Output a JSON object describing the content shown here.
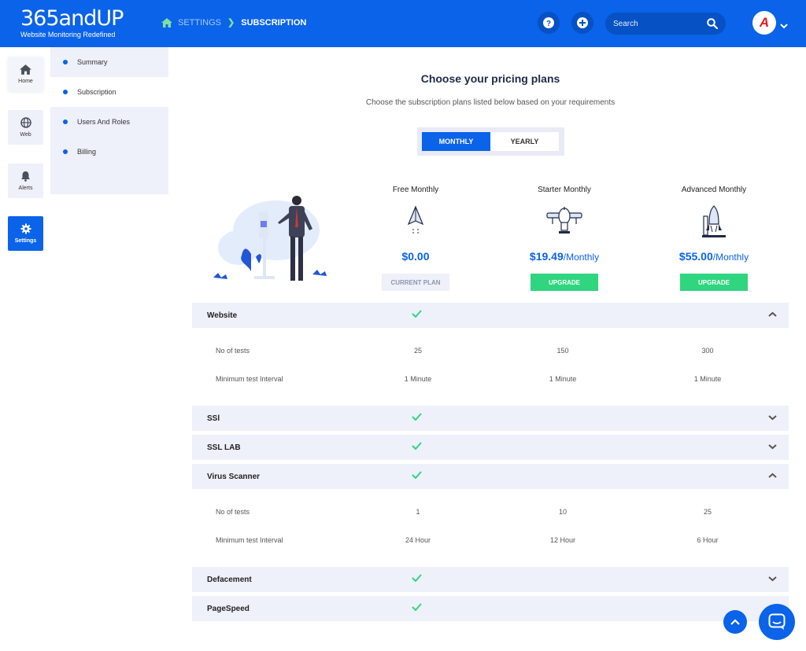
{
  "brand": {
    "name": "365andUP",
    "tagline": "Website Monitoring Redefined"
  },
  "breadcrumb": {
    "section": "SETTINGS",
    "current": "SUBSCRIPTION"
  },
  "header": {
    "search_placeholder": "Search",
    "avatar_letter": "A"
  },
  "leftnav": [
    {
      "label": "Home",
      "icon": "home-icon"
    },
    {
      "label": "Web",
      "icon": "globe-icon"
    },
    {
      "label": "Alerts",
      "icon": "bell-icon"
    },
    {
      "label": "Settings",
      "icon": "gear-icon",
      "active": true
    }
  ],
  "subnav": [
    {
      "label": "Summary"
    },
    {
      "label": "Subscription",
      "active": true
    },
    {
      "label": "Users And Roles"
    },
    {
      "label": "Billing"
    }
  ],
  "main": {
    "title": "Choose your pricing plans",
    "subtitle": "Choose the subscription plans listed below based on your requirements",
    "toggle": {
      "monthly": "MONTHLY",
      "yearly": "YEARLY",
      "selected": "MONTHLY"
    }
  },
  "plans": [
    {
      "name": "Free Monthly",
      "price": "$0.00",
      "period": "",
      "button": "CURRENT PLAN",
      "icon": "paper-plane-icon"
    },
    {
      "name": "Starter Monthly",
      "price": "$19.49",
      "period": "/Monthly",
      "button": "UPGRADE",
      "icon": "airplane-icon"
    },
    {
      "name": "Advanced Monthly",
      "price": "$55.00",
      "period": "/Monthly",
      "button": "UPGRADE",
      "icon": "rocket-icon"
    }
  ],
  "features": [
    {
      "name": "Website",
      "expanded": true,
      "rows": [
        {
          "label": "No of tests",
          "values": [
            "25",
            "150",
            "300"
          ]
        },
        {
          "label": "Minimum test Interval",
          "values": [
            "1 Minute",
            "1 Minute",
            "1 Minute"
          ]
        }
      ]
    },
    {
      "name": "SSl",
      "expanded": false
    },
    {
      "name": "SSL LAB",
      "expanded": false
    },
    {
      "name": "Virus Scanner",
      "expanded": true,
      "rows": [
        {
          "label": "No of tests",
          "values": [
            "1",
            "10",
            "25"
          ]
        },
        {
          "label": "Minimum test Interval",
          "values": [
            "24 Hour",
            "12 Hour",
            "6 Hour"
          ]
        }
      ]
    },
    {
      "name": "Defacement",
      "expanded": false
    },
    {
      "name": "PageSpeed",
      "expanded": false
    }
  ],
  "colors": {
    "primary": "#0a63e8",
    "success": "#2fd57f",
    "panel": "#eef0fa"
  }
}
